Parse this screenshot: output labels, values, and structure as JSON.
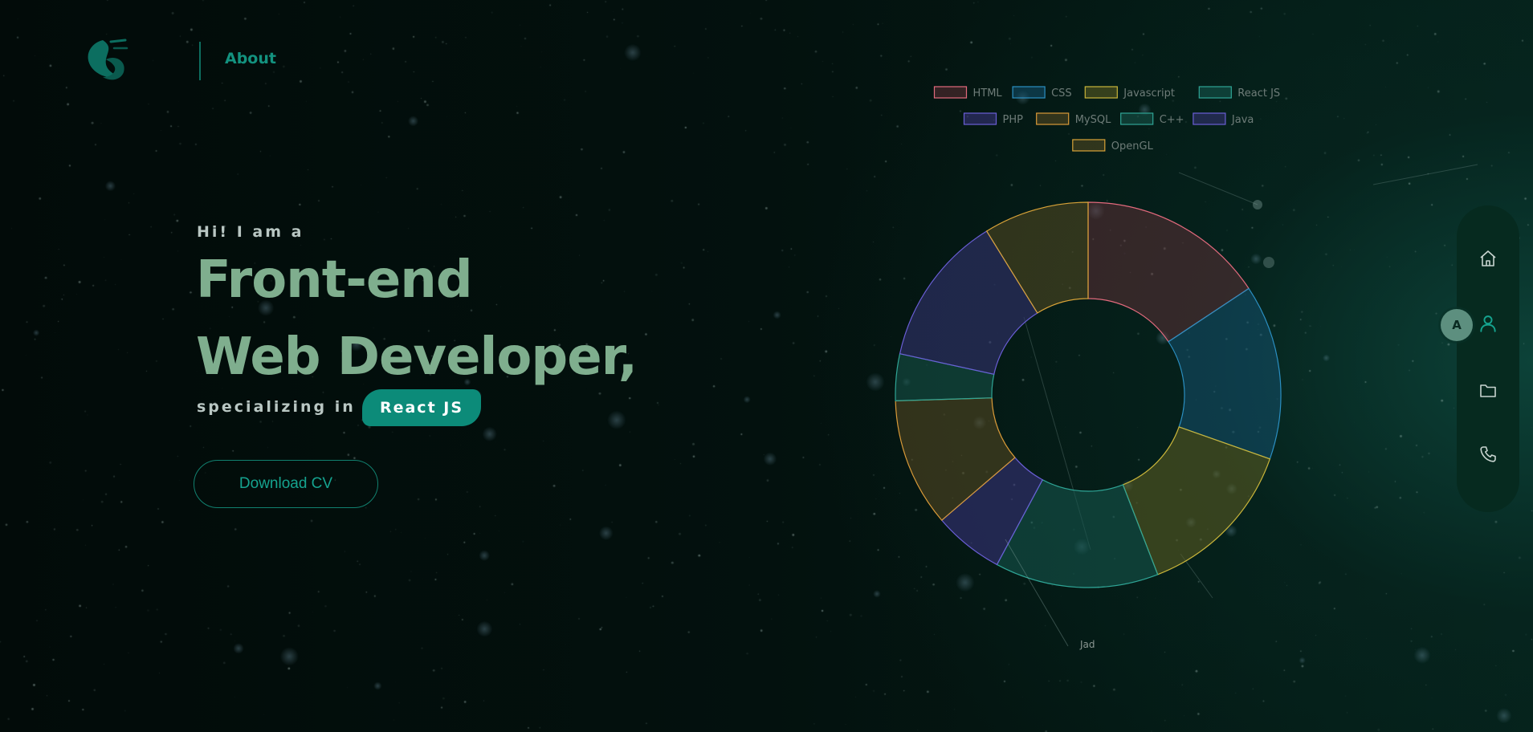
{
  "nav": {
    "about_label": "About"
  },
  "hero": {
    "intro": "Hi! I am a",
    "headline_line1": "Front-end",
    "headline_line2": "Web Developer,",
    "specializing": "specializing in",
    "specialty": "React JS",
    "download_label": "Download CV"
  },
  "side_nav": {
    "avatar_initial": "A",
    "icons": [
      "home-icon",
      "user-icon",
      "folder-icon",
      "phone-icon"
    ],
    "active": "user-icon"
  },
  "colors": {
    "accent": "#0c8b79",
    "headline": "#7fae8e",
    "background": "#020c0a"
  },
  "chart_data": {
    "type": "pie",
    "donut": true,
    "legend_position": "top",
    "series": [
      {
        "name": "HTML",
        "value": 16,
        "color": "#e26a7d",
        "fill": "rgba(110,50,60,0.45)"
      },
      {
        "name": "CSS",
        "value": 15,
        "color": "#2b8fc2",
        "fill": "rgba(20,80,110,0.55)"
      },
      {
        "name": "Javascript",
        "value": 14,
        "color": "#c9b53a",
        "fill": "rgba(95,95,35,0.55)"
      },
      {
        "name": "React JS",
        "value": 14,
        "color": "#2fa596",
        "fill": "rgba(22,90,80,0.55)"
      },
      {
        "name": "PHP",
        "value": 6,
        "color": "#6a5ed6",
        "fill": "rgba(55,50,120,0.6)"
      },
      {
        "name": "MySQL",
        "value": 11,
        "color": "#d99a38",
        "fill": "rgba(90,75,35,0.55)"
      },
      {
        "name": "C++",
        "value": 4,
        "color": "#2fa596",
        "fill": "rgba(22,80,70,0.6)"
      },
      {
        "name": "Java",
        "value": 13,
        "color": "#6a5ed6",
        "fill": "rgba(50,50,110,0.6)"
      },
      {
        "name": "OpenGL",
        "value": 9,
        "color": "#d9a338",
        "fill": "rgba(85,75,35,0.55)"
      }
    ],
    "annotation": "Jad"
  }
}
